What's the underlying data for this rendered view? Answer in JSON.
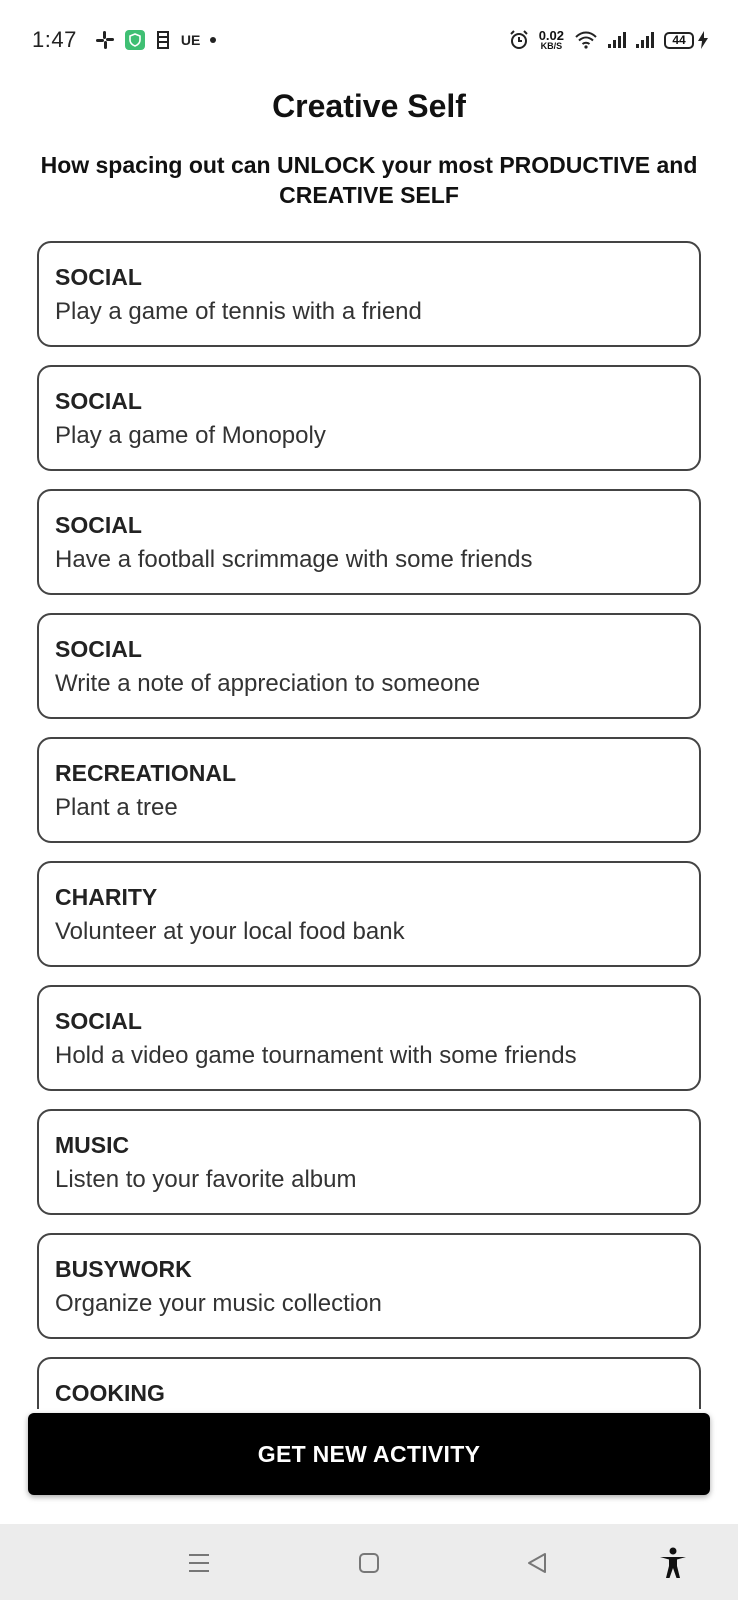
{
  "status_bar": {
    "time": "1:47",
    "carrier_text": "UE",
    "net_speed_value": "0.02",
    "net_speed_unit": "KB/S",
    "battery": "44",
    "icons": [
      "slack-icon",
      "shield-icon",
      "calendar-icon",
      "alarm-icon",
      "wifi-icon",
      "signal-icon",
      "charging-icon"
    ]
  },
  "header": {
    "title": "Creative Self",
    "subtitle": "How spacing out can UNLOCK your most PRODUCTIVE and CREATIVE SELF"
  },
  "activities": [
    {
      "type": "SOCIAL",
      "activity": "Play a game of tennis with a friend"
    },
    {
      "type": "SOCIAL",
      "activity": "Play a game of Monopoly"
    },
    {
      "type": "SOCIAL",
      "activity": "Have a football scrimmage with some friends"
    },
    {
      "type": "SOCIAL",
      "activity": "Write a note of appreciation to someone"
    },
    {
      "type": "RECREATIONAL",
      "activity": "Plant a tree"
    },
    {
      "type": "CHARITY",
      "activity": "Volunteer at your local food bank"
    },
    {
      "type": "SOCIAL",
      "activity": "Hold a video game tournament with some friends"
    },
    {
      "type": "MUSIC",
      "activity": "Listen to your favorite album"
    },
    {
      "type": "BUSYWORK",
      "activity": "Organize your music collection"
    },
    {
      "type": "COOKING",
      "activity": ""
    }
  ],
  "cta": {
    "label": "GET NEW ACTIVITY"
  },
  "nav_bar": {
    "icons": [
      "menu-icon",
      "home-icon",
      "back-icon",
      "accessibility-icon"
    ]
  },
  "colors": {
    "background": "#ffffff",
    "button": "#000000",
    "card_border": "#444444",
    "nav_bar": "#ececec"
  }
}
